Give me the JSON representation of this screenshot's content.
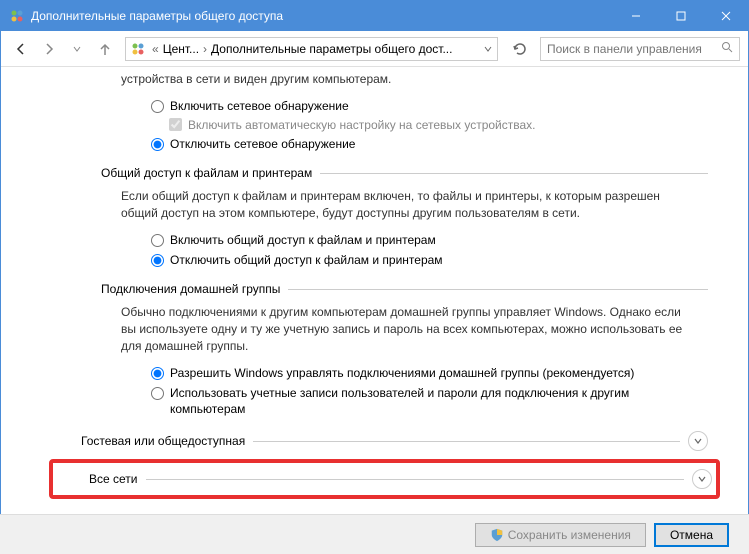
{
  "window": {
    "title": "Дополнительные параметры общего доступа"
  },
  "breadcrumb": {
    "item1": "Цент...",
    "item2": "Дополнительные параметры общего дост..."
  },
  "search": {
    "placeholder": "Поиск в панели управления"
  },
  "topCut": "устройства в сети и виден другим компьютерам.",
  "networkDiscovery": {
    "on": "Включить сетевое обнаружение",
    "autoCheck": "Включить автоматическую настройку на сетевых устройствах.",
    "off": "Отключить сетевое обнаружение"
  },
  "filePrinter": {
    "title": "Общий доступ к файлам и принтерам",
    "desc": "Если общий доступ к файлам и принтерам включен, то файлы и принтеры, к которым разрешен общий доступ на этом компьютере, будут доступны другим пользователям в сети.",
    "on": "Включить общий доступ к файлам и принтерам",
    "off": "Отключить общий доступ к файлам и принтерам"
  },
  "homegroup": {
    "title": "Подключения домашней группы",
    "desc": "Обычно подключениями к другим компьютерам домашней группы управляет Windows. Однако если вы используете одну и ту же учетную запись и пароль на всех компьютерах, можно использовать ее для домашней группы.",
    "opt1": "Разрешить Windows управлять подключениями домашней группы (рекомендуется)",
    "opt2": "Использовать учетные записи пользователей и пароли для подключения к другим компьютерам"
  },
  "profiles": {
    "guest": "Гостевая или общедоступная",
    "all": "Все сети"
  },
  "buttons": {
    "save": "Сохранить изменения",
    "cancel": "Отмена"
  }
}
